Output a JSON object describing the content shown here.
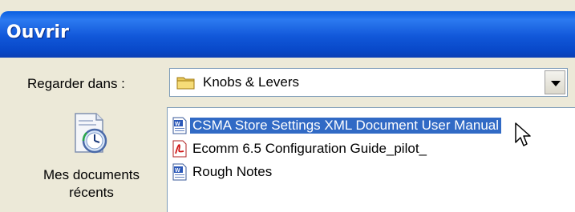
{
  "dialog": {
    "title": "Ouvrir"
  },
  "look_in": {
    "label": "Regarder dans :",
    "value": "Knobs & Levers",
    "folder_icon": "folder-icon",
    "dropdown_icon": "chevron-down-icon"
  },
  "places": [
    {
      "label_line1": "Mes documents",
      "label_line2": "récents",
      "icon": "recent-documents-icon"
    }
  ],
  "files": [
    {
      "name": "CSMA Store Settings XML Document User Manual",
      "icon": "word-document-icon",
      "selected": true
    },
    {
      "name": "Ecomm 6.5 Configuration Guide_pilot_",
      "icon": "pdf-document-icon",
      "selected": false
    },
    {
      "name": "Rough Notes",
      "icon": "word-document-icon",
      "selected": false
    }
  ],
  "colors": {
    "titlebar": "#0a5fe0",
    "selection": "#316ac5",
    "dialog_bg": "#ece9d8"
  }
}
